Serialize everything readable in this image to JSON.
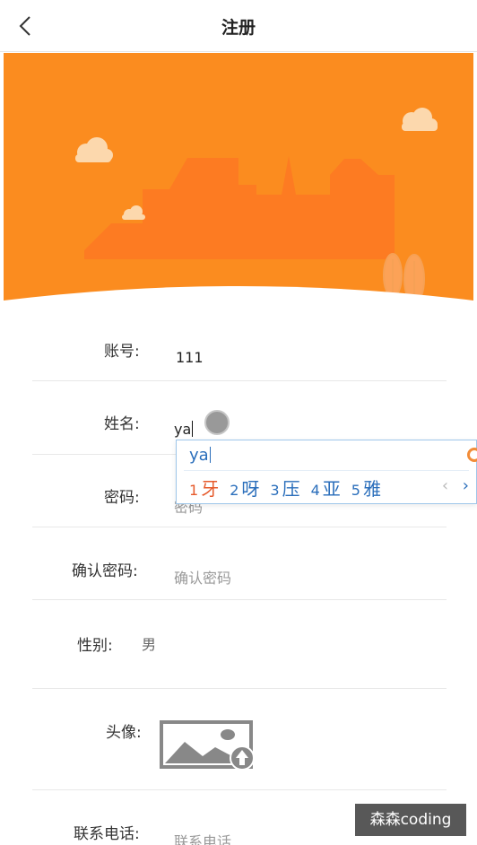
{
  "header": {
    "title": "注册",
    "back_icon": "chevron-left-icon"
  },
  "form": {
    "account": {
      "label": "账号:",
      "value": "111"
    },
    "name": {
      "label": "姓名:",
      "value": "ya"
    },
    "password": {
      "label": "密码:",
      "placeholder": "密码"
    },
    "confirm": {
      "label": "确认密码:",
      "placeholder": "确认密码"
    },
    "gender": {
      "label": "性别:",
      "value": "男"
    },
    "avatar": {
      "label": "头像:",
      "icon": "image-upload-icon"
    },
    "phone": {
      "label": "联系电话:",
      "placeholder": "联系电话"
    }
  },
  "ime": {
    "input": "ya",
    "candidates": [
      {
        "num": "1",
        "text": "牙"
      },
      {
        "num": "2",
        "text": "呀"
      },
      {
        "num": "3",
        "text": "压"
      },
      {
        "num": "4",
        "text": "亚"
      },
      {
        "num": "5",
        "text": "雅"
      }
    ],
    "prev": "‹",
    "next": "›"
  },
  "watermark": "森森coding",
  "colors": {
    "banner": "#fb8c1f",
    "building": "#fd7b22",
    "ime_text": "#2a6ebb",
    "ime_active": "#e65a2b"
  }
}
